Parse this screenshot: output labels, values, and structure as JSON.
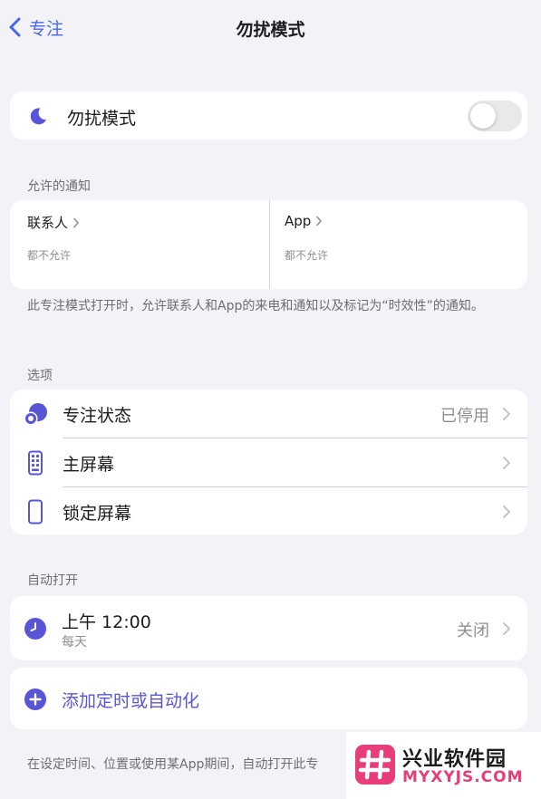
{
  "nav": {
    "back_label": "专注",
    "title": "勿扰模式"
  },
  "dnd": {
    "label": "勿扰模式",
    "enabled": false
  },
  "allowed": {
    "header": "允许的通知",
    "people": {
      "title": "联系人",
      "subtitle": "都不允许"
    },
    "apps": {
      "title": "App",
      "subtitle": "都不允许"
    },
    "footnote": "此专注模式打开时，允许联系人和App的来电和通知以及标记为“时效性”的通知。"
  },
  "options": {
    "header": "选项",
    "items": [
      {
        "label": "专注状态",
        "value": "已停用"
      },
      {
        "label": "主屏幕",
        "value": ""
      },
      {
        "label": "锁定屏幕",
        "value": ""
      }
    ]
  },
  "auto": {
    "header": "自动打开",
    "schedule": {
      "time": "上午 12:00",
      "repeat": "每天",
      "state": "关闭"
    },
    "add_label": "添加定时或自动化",
    "footnote": "在设定时间、位置或使用某App期间，自动打开此专"
  },
  "watermark": {
    "cn": "兴业软件园",
    "en": "MYXYJS.COM"
  },
  "colors": {
    "accent": "#5856d6",
    "link_blue": "#4668f0",
    "background": "#f2f2f7",
    "watermark_pink": "#e93d7a"
  }
}
